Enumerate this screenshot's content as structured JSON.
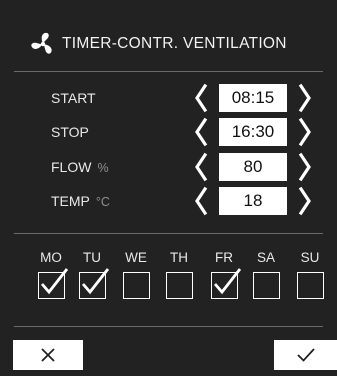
{
  "header": {
    "title": "TIMER-CONTR. VENTILATION",
    "icon": "fan-icon"
  },
  "settings": [
    {
      "key": "start",
      "label": "START",
      "unit": "",
      "value": "08:15"
    },
    {
      "key": "stop",
      "label": "STOP",
      "unit": "",
      "value": "16:30"
    },
    {
      "key": "flow",
      "label": "FLOW",
      "unit": "%",
      "value": "80"
    },
    {
      "key": "temp",
      "label": "TEMP",
      "unit": "°C",
      "value": "18"
    }
  ],
  "days": [
    {
      "label": "MO",
      "checked": true
    },
    {
      "label": "TU",
      "checked": true
    },
    {
      "label": "WE",
      "checked": false
    },
    {
      "label": "TH",
      "checked": false
    },
    {
      "label": "FR",
      "checked": true
    },
    {
      "label": "SA",
      "checked": false
    },
    {
      "label": "SU",
      "checked": false
    }
  ],
  "footer": {
    "cancel_icon": "close-icon",
    "ok_icon": "checkmark-icon"
  },
  "colors": {
    "background": "#222222",
    "foreground": "#ffffff",
    "divider": "#6a6a6a",
    "unit_text": "#8f8f8f"
  }
}
